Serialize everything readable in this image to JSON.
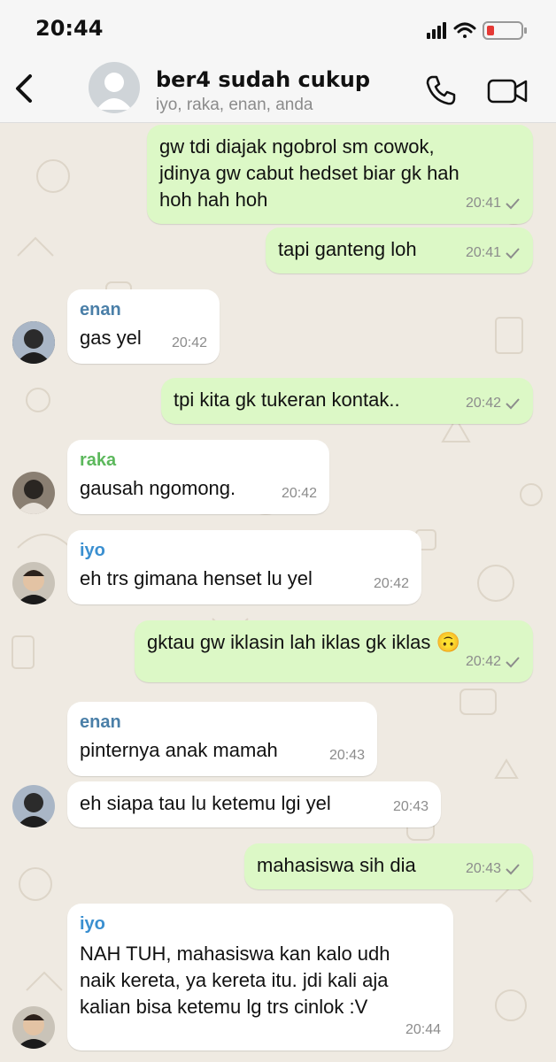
{
  "status_bar": {
    "time": "20:44"
  },
  "header": {
    "title": "ber4 sudah cukup",
    "members": "iyo, raka, enan, anda"
  },
  "colors": {
    "outgoing_bubble": "#dcf8c6",
    "incoming_bubble": "#ffffff",
    "sender_enan": "#4a7fa8",
    "sender_raka": "#5cb85c",
    "sender_iyo": "#3a8fd0"
  },
  "icons": [
    "back-chevron-icon",
    "group-avatar-icon",
    "phone-icon",
    "video-camera-icon",
    "signal-icon",
    "wifi-icon",
    "battery-icon",
    "read-tick-icon"
  ],
  "messages": [
    {
      "direction": "out",
      "text": "gw tdi diajak ngobrol sm cowok,\njdinya gw cabut hedset biar gk hah\nhoh hah hoh",
      "time": "20:41"
    },
    {
      "direction": "out",
      "text": "tapi ganteng loh",
      "time": "20:41"
    },
    {
      "direction": "in",
      "sender": "enan",
      "text": "gas yel",
      "time": "20:42"
    },
    {
      "direction": "out",
      "text": "tpi kita gk tukeran kontak..",
      "time": "20:42"
    },
    {
      "direction": "in",
      "sender": "raka",
      "text": "gausah ngomong.",
      "time": "20:42"
    },
    {
      "direction": "in",
      "sender": "iyo",
      "text": "eh trs gimana henset lu yel",
      "time": "20:42"
    },
    {
      "direction": "out",
      "text": "gktau gw iklasin lah iklas gk iklas 🙃",
      "time": "20:42"
    },
    {
      "direction": "in",
      "sender": "enan",
      "text": "pinternya anak mamah",
      "time": "20:43"
    },
    {
      "direction": "in",
      "text": "eh siapa tau lu ketemu lgi yel",
      "time": "20:43"
    },
    {
      "direction": "out",
      "text": "mahasiswa sih dia",
      "time": "20:43"
    },
    {
      "direction": "in",
      "sender": "iyo",
      "text": "NAH TUH, mahasiswa kan kalo udh\nnaik kereta, ya kereta itu. jdi kali aja\nkalian bisa ketemu lg trs cinlok :V",
      "time": "20:44"
    }
  ]
}
